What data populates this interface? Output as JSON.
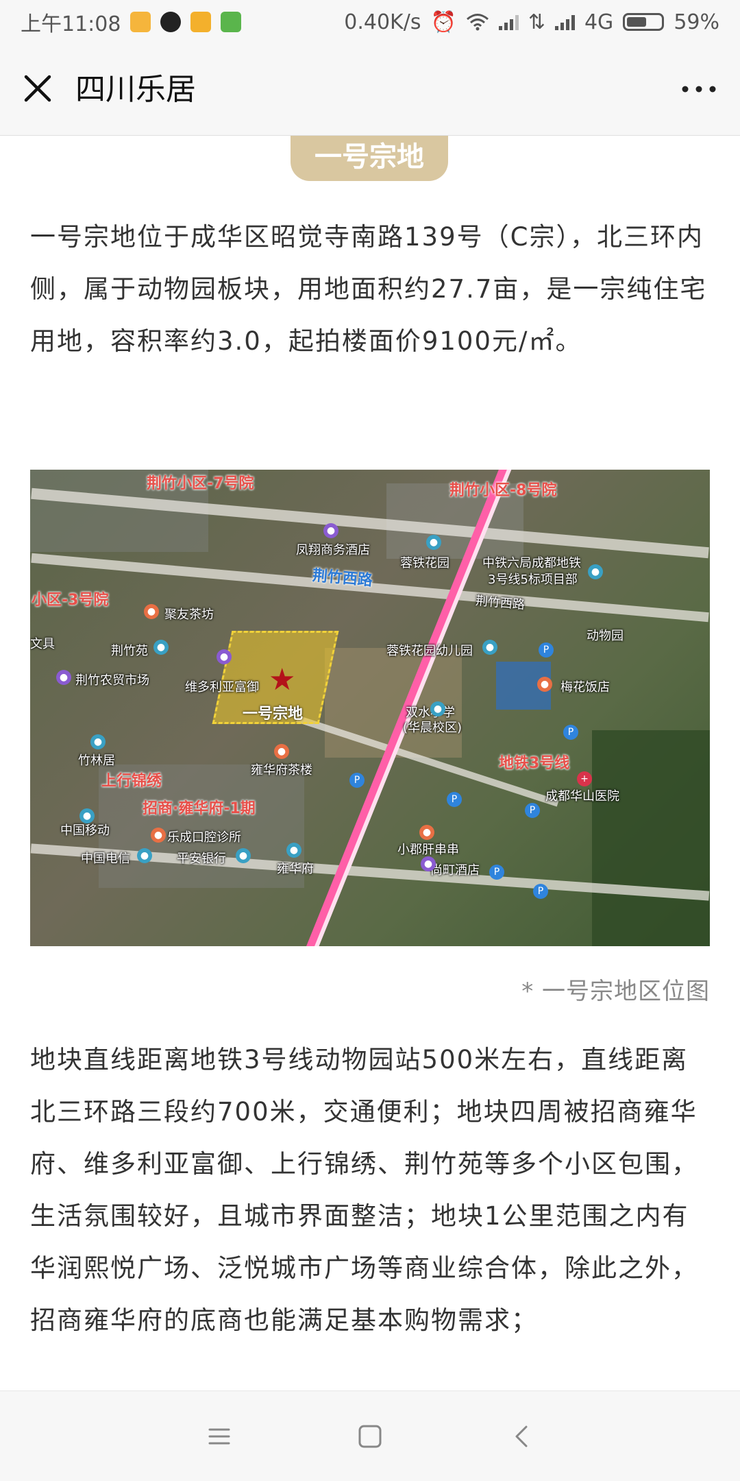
{
  "status_bar": {
    "time": "上午11:08",
    "net_speed": "0.40K/s",
    "network": "4G",
    "battery": "59%",
    "battery_level": 0.59
  },
  "title_bar": {
    "title": "四川乐居",
    "close_icon": "close-icon",
    "more_icon": "more-icon"
  },
  "article": {
    "tag": "一号宗地",
    "para1": "一号宗地位于成华区昭觉寺南路139号（C宗），北三环内侧，属于动物园板块，用地面积约27.7亩，是一宗纯住宅用地，容积率约3.0，起拍楼面价9100元/㎡。",
    "caption": "* 一号宗地区位图",
    "para2": "地块直线距离地铁3号线动物园站500米左右，直线距离北三环路三段约700米，交通便利；地块四周被招商雍华府、维多利亚富御、上行锦绣、荆竹苑等多个小区包围，生活氛围较好，且城市界面整洁；地块1公里范围之内有华润熙悦广场、泛悦城市广场等商业综合体，除此之外，招商雍华府的底商也能满足基本购物需求；"
  },
  "map": {
    "labels": {
      "area7": "荆竹小区-7号院",
      "area8": "荆竹小区-8号院",
      "area3": "小区-3号院",
      "road1": "荆竹西路",
      "road2": "荆竹西路",
      "hotel1": "凤翔商务酒店",
      "garden": "蓉铁花园",
      "metro_project": "中铁六局成都地铁",
      "metro_project2": "3号线5标项目部",
      "tea": "聚友茶坊",
      "jingzhuyuan": "荆竹苑",
      "market": "荆竹农贸市场",
      "victoria": "维多利亚富御",
      "plot": "一号宗地",
      "kindergarten": "蓉铁花园幼儿园",
      "zoo": "动物园",
      "meihua": "梅花饭店",
      "school": "双水小学",
      "school2": "(华晨校区)",
      "zhulinju": "竹林居",
      "shangxing": "上行锦绣",
      "teahouse2": "雍华府茶楼",
      "metro3": "地铁3号线",
      "hospital": "成都华山医院",
      "zhaoshang": "招商·雍华府-1期",
      "mobile": "中国移动",
      "dental": "乐成口腔诊所",
      "telecom": "中国电信",
      "bank": "平安银行",
      "yonghuafu": "雍华府",
      "xiaojun": "小郡肝串串",
      "shangding": "尚町酒店",
      "wenju": "文具"
    }
  },
  "nav_bar": {
    "menu_icon": "menu-icon",
    "home_icon": "home-icon",
    "back_icon": "back-icon"
  }
}
